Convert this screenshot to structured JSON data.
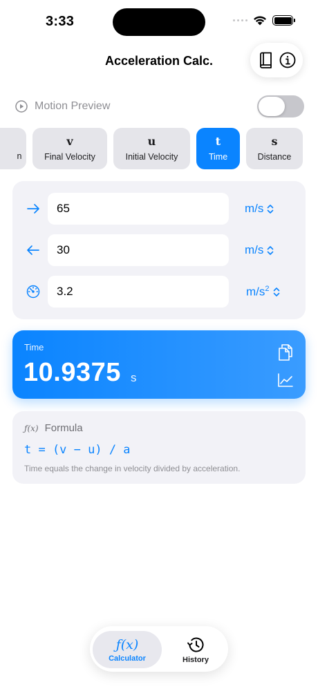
{
  "status_bar": {
    "time": "3:33"
  },
  "nav": {
    "title": "Acceleration Calc.",
    "actions": [
      "book-icon",
      "info-icon"
    ]
  },
  "preview": {
    "label": "Motion Preview",
    "enabled": false
  },
  "variables": [
    {
      "symbol": "",
      "label": "n",
      "active": false
    },
    {
      "symbol": "v",
      "label": "Final Velocity",
      "active": false
    },
    {
      "symbol": "u",
      "label": "Initial Velocity",
      "active": false
    },
    {
      "symbol": "t",
      "label": "Time",
      "active": true
    },
    {
      "symbol": "s",
      "label": "Distance",
      "active": false
    }
  ],
  "inputs": [
    {
      "icon": "arrow-right-icon",
      "value": "65",
      "unit": "m/s"
    },
    {
      "icon": "arrow-left-icon",
      "value": "30",
      "unit": "m/s"
    },
    {
      "icon": "speedometer-icon",
      "value": "3.2",
      "unit_base": "m/s",
      "unit_sup": "2"
    }
  ],
  "result": {
    "label": "Time",
    "value": "10.9375",
    "unit": "s"
  },
  "formula": {
    "fx_glyph": "ƒ(x)",
    "title": "Formula",
    "expression": "t = (v − u) / a",
    "description": "Time equals the change in velocity divided by acceleration."
  },
  "tabs": [
    {
      "glyph": "ƒ(x)",
      "label": "Calculator",
      "active": true
    },
    {
      "glyph": "",
      "label": "History",
      "active": false
    }
  ],
  "colors": {
    "accent": "#0a84ff",
    "card_bg": "#f2f2f7",
    "segment_bg": "#e5e5ea"
  }
}
